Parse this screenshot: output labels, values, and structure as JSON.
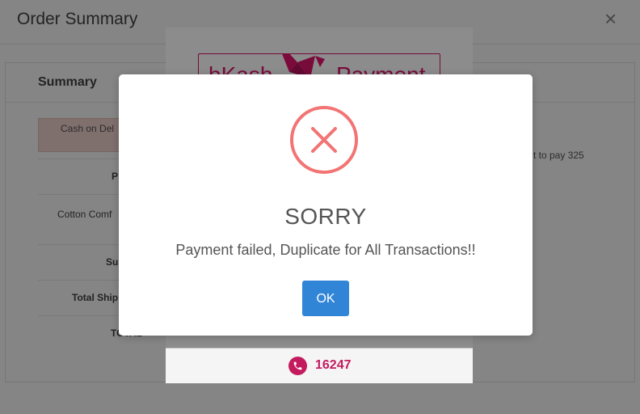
{
  "order_modal": {
    "title": "Order Summary",
    "close_icon": "close-icon",
    "summary_title": "Summary",
    "payment_method": "Cash on Del",
    "rows": [
      {
        "label": "P",
        "bold": true
      },
      {
        "label": "Cotton Comf",
        "bold": false
      },
      {
        "label": "Su",
        "bold": true
      },
      {
        "label": "Total Ship",
        "bold": true
      },
      {
        "label": "TOTAL",
        "bold": true
      }
    ],
    "right_note": "t to pay 325"
  },
  "bkash": {
    "logo_left": "bKash",
    "logo_right": "Payment",
    "hotline": "16247",
    "phone_icon": "phone-icon",
    "brand_color": "#d9146b"
  },
  "dialog": {
    "icon": "error-x-icon",
    "icon_color": "#f27474",
    "title": "SORRY",
    "message": "Payment failed, Duplicate for All Transactions!!",
    "ok_label": "OK",
    "button_color": "#3085d6"
  }
}
